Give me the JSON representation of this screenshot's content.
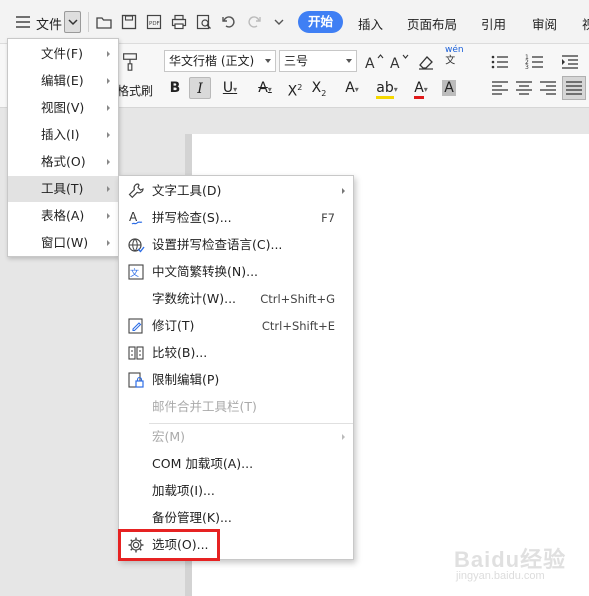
{
  "title_bar": {
    "file_label": "文件",
    "tabs": [
      "开始",
      "插入",
      "页面布局",
      "引用",
      "审阅",
      "视"
    ]
  },
  "ribbon": {
    "font_name": "华文行楷 (正文)",
    "font_size": "三号",
    "format_painter_label": "格式刷",
    "pinyin_label": "wén"
  },
  "menu": {
    "items": [
      {
        "label": "文件(F)"
      },
      {
        "label": "编辑(E)"
      },
      {
        "label": "视图(V)"
      },
      {
        "label": "插入(I)"
      },
      {
        "label": "格式(O)"
      },
      {
        "label": "工具(T)"
      },
      {
        "label": "表格(A)"
      },
      {
        "label": "窗口(W)"
      }
    ],
    "active_index": 5
  },
  "tools_submenu": {
    "items": [
      {
        "label": "文字工具(D)",
        "shortcut": "",
        "icon": "wrench-icon"
      },
      {
        "label": "拼写检查(S)...",
        "shortcut": "F7",
        "icon": "spellcheck-icon"
      },
      {
        "label": "设置拼写检查语言(C)...",
        "shortcut": "",
        "icon": "globe-language-icon"
      },
      {
        "label": "中文简繁转换(N)...",
        "shortcut": "",
        "icon": "simplified-traditional-icon"
      },
      {
        "label": "字数统计(W)...",
        "shortcut": "Ctrl+Shift+G",
        "icon": ""
      },
      {
        "label": "修订(T)",
        "shortcut": "Ctrl+Shift+E",
        "icon": "track-changes-icon"
      },
      {
        "label": "比较(B)...",
        "shortcut": "",
        "icon": "compare-icon"
      },
      {
        "label": "限制编辑(P)",
        "shortcut": "",
        "icon": "restrict-edit-icon"
      },
      {
        "label": "邮件合并工具栏(T)",
        "shortcut": "",
        "icon": ""
      },
      {
        "label": "宏(M)",
        "shortcut": "",
        "icon": ""
      },
      {
        "label": "COM 加载项(A)...",
        "shortcut": "",
        "icon": ""
      },
      {
        "label": "加载项(I)...",
        "shortcut": "",
        "icon": ""
      },
      {
        "label": "备份管理(K)...",
        "shortcut": "",
        "icon": ""
      },
      {
        "label": "选项(O)...",
        "shortcut": "",
        "icon": "gear-icon"
      }
    ]
  },
  "watermark": {
    "text": "Baidu经验",
    "sub": "jingyan.baidu.com"
  },
  "colors": {
    "accent": "#3f7ff4",
    "highlight_box": "#e62222",
    "menu_active": "#e2e2e2"
  }
}
